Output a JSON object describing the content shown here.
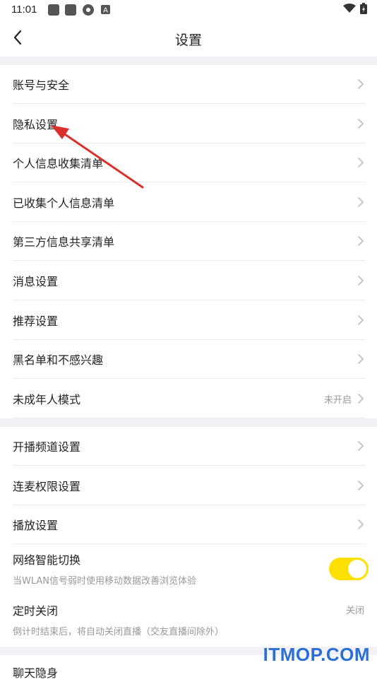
{
  "status_bar": {
    "time": "11:01"
  },
  "header": {
    "title": "设置",
    "back_icon": "chevron-left-icon"
  },
  "group1": [
    {
      "label": "账号与安全"
    },
    {
      "label": "隐私设置"
    },
    {
      "label": "个人信息收集清单"
    },
    {
      "label": "已收集个人信息清单"
    },
    {
      "label": "第三方信息共享清单"
    },
    {
      "label": "消息设置"
    },
    {
      "label": "推荐设置"
    },
    {
      "label": "黑名单和不感兴趣"
    },
    {
      "label": "未成年人模式",
      "value": "未开启"
    }
  ],
  "group2": [
    {
      "label": "开播频道设置"
    },
    {
      "label": "连麦权限设置"
    },
    {
      "label": "播放设置"
    }
  ],
  "network_switch": {
    "label": "网络智能切换",
    "subtitle": "当WLAN信号弱时使用移动数据改善浏览体验",
    "enabled": true
  },
  "timer_off": {
    "label": "定时关闭",
    "subtitle": "倒计时结束后，将自动关闭直播（交友直播间除外）",
    "value": "关闭"
  },
  "group3_partial": {
    "label": "聊天隐身"
  },
  "colors": {
    "toggle_on": "#ffe000",
    "annotation_arrow": "#d9302b",
    "watermark": "#2b6fd6"
  },
  "watermark": "ITMOP.COM"
}
